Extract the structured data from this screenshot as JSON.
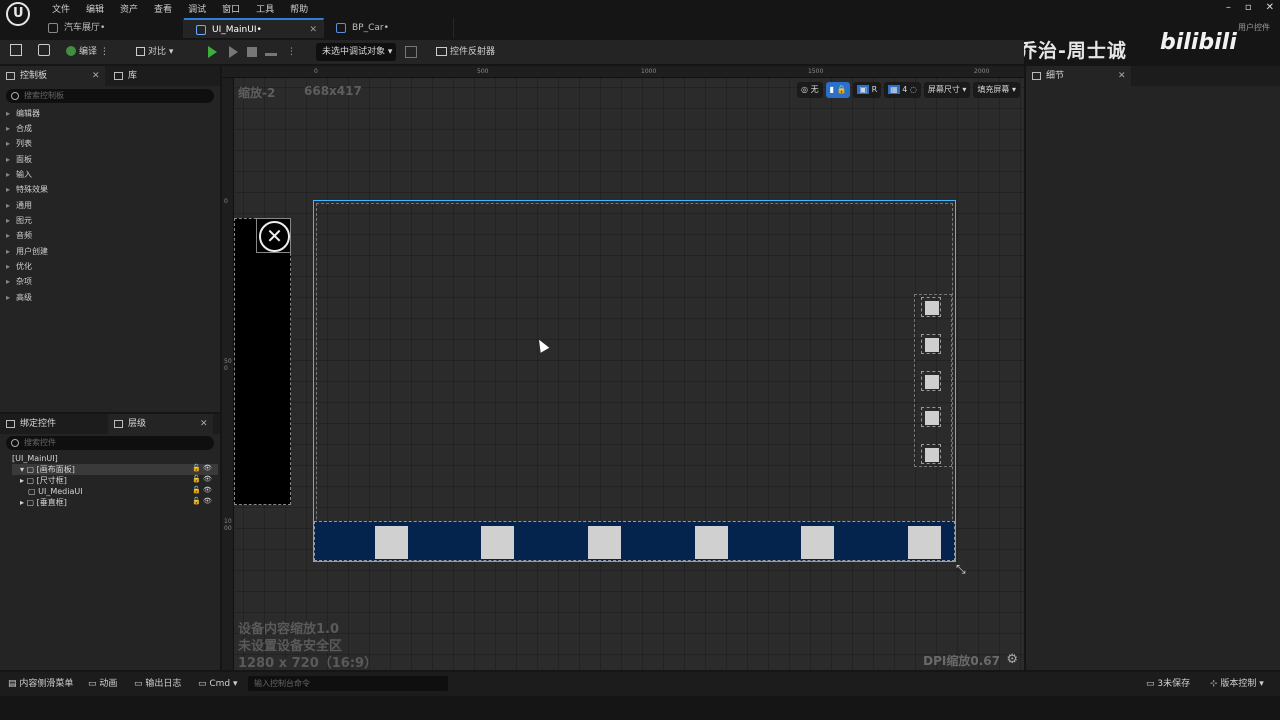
{
  "menu": [
    "文件",
    "编辑",
    "资产",
    "查看",
    "调试",
    "窗口",
    "工具",
    "帮助"
  ],
  "tabs": [
    {
      "label": "汽车展厅•",
      "active": false
    },
    {
      "label": "UI_MainUI•",
      "active": true
    },
    {
      "label": "BP_Car•",
      "active": false
    }
  ],
  "window": {
    "minimize": "–",
    "maximize": "▫",
    "close": "✕",
    "user_control": "用户控件"
  },
  "watermark": {
    "author": "乔治-周士诚",
    "site": "bilibili"
  },
  "toolbar": {
    "compile": "编译",
    "diff": "对比",
    "debug_object": "未选中调试对象",
    "widget_reflector": "控件反射器"
  },
  "palette": {
    "tab_label": "控制板",
    "library_label": "库",
    "search_placeholder": "搜索控制板",
    "categories": [
      "编辑器",
      "合成",
      "列表",
      "面板",
      "输入",
      "特殊效果",
      "通用",
      "图元",
      "音频",
      "用户创建",
      "优化",
      "杂项",
      "高级"
    ]
  },
  "hierarchy": {
    "bind_tab": "绑定控件",
    "tab_label": "层级",
    "search_placeholder": "搜索控件",
    "items": [
      {
        "label": "[UI_MainUI]"
      },
      {
        "label": "[画布面板]"
      },
      {
        "label": "[尺寸框]"
      },
      {
        "label": "UI_MediaUI"
      },
      {
        "label": "[垂直框]"
      }
    ]
  },
  "viewport": {
    "zoom": "缩放-2",
    "size": "668x417",
    "ruler_top": [
      "0",
      "500",
      "1000",
      "1500",
      "2000"
    ],
    "ruler_left": [
      "0",
      "500",
      "1000"
    ],
    "tools": {
      "none": "无",
      "r": "R",
      "grid": "4",
      "screen_size": "屏幕尺寸",
      "fill_screen": "填充屏幕"
    },
    "footer_scale": "设备内容缩放1.0",
    "footer_safe": "未设置设备安全区",
    "footer_res": "1280 x 720（16:9）",
    "dpi": "DPI缩放0.67"
  },
  "details": {
    "tab_label": "细节"
  },
  "statusbar": {
    "content_drawer": "内容侧滑菜单",
    "animation": "动画",
    "output_log": "输出日志",
    "cmd": "Cmd",
    "cmd_placeholder": "输入控制台命令",
    "unsaved": "3未保存",
    "source_control": "版本控制"
  }
}
